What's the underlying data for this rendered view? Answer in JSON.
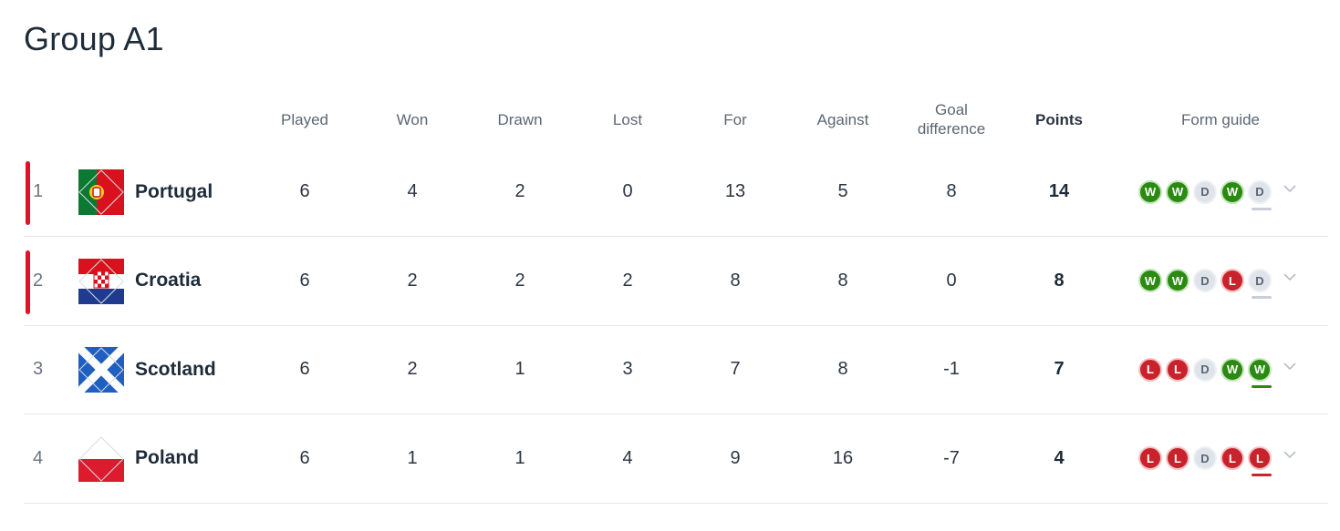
{
  "group_title": "Group A1",
  "columns": {
    "played": "Played",
    "won": "Won",
    "drawn": "Drawn",
    "lost": "Lost",
    "for": "For",
    "against": "Against",
    "goal_difference_1": "Goal",
    "goal_difference_2": "difference",
    "points": "Points",
    "form_guide": "Form guide"
  },
  "colors": {
    "qualify": "#e0112b",
    "win": "#2a8a12",
    "loss": "#c8232c",
    "draw": "#dfe3ea"
  },
  "rows": [
    {
      "pos": "1",
      "team": "Portugal",
      "flag": "portugal-flag-icon",
      "played": "6",
      "won": "4",
      "drawn": "2",
      "lost": "0",
      "for": "13",
      "against": "5",
      "gd": "8",
      "points": "14",
      "qualified": true,
      "form": [
        "W",
        "W",
        "D",
        "W",
        "D"
      ]
    },
    {
      "pos": "2",
      "team": "Croatia",
      "flag": "croatia-flag-icon",
      "played": "6",
      "won": "2",
      "drawn": "2",
      "lost": "2",
      "for": "8",
      "against": "8",
      "gd": "0",
      "points": "8",
      "qualified": true,
      "form": [
        "W",
        "W",
        "D",
        "L",
        "D"
      ]
    },
    {
      "pos": "3",
      "team": "Scotland",
      "flag": "scotland-flag-icon",
      "played": "6",
      "won": "2",
      "drawn": "1",
      "lost": "3",
      "for": "7",
      "against": "8",
      "gd": "-1",
      "points": "7",
      "qualified": false,
      "form": [
        "L",
        "L",
        "D",
        "W",
        "W"
      ]
    },
    {
      "pos": "4",
      "team": "Poland",
      "flag": "poland-flag-icon",
      "played": "6",
      "won": "1",
      "drawn": "1",
      "lost": "4",
      "for": "9",
      "against": "16",
      "gd": "-7",
      "points": "4",
      "qualified": false,
      "form": [
        "L",
        "L",
        "D",
        "L",
        "L"
      ]
    }
  ]
}
